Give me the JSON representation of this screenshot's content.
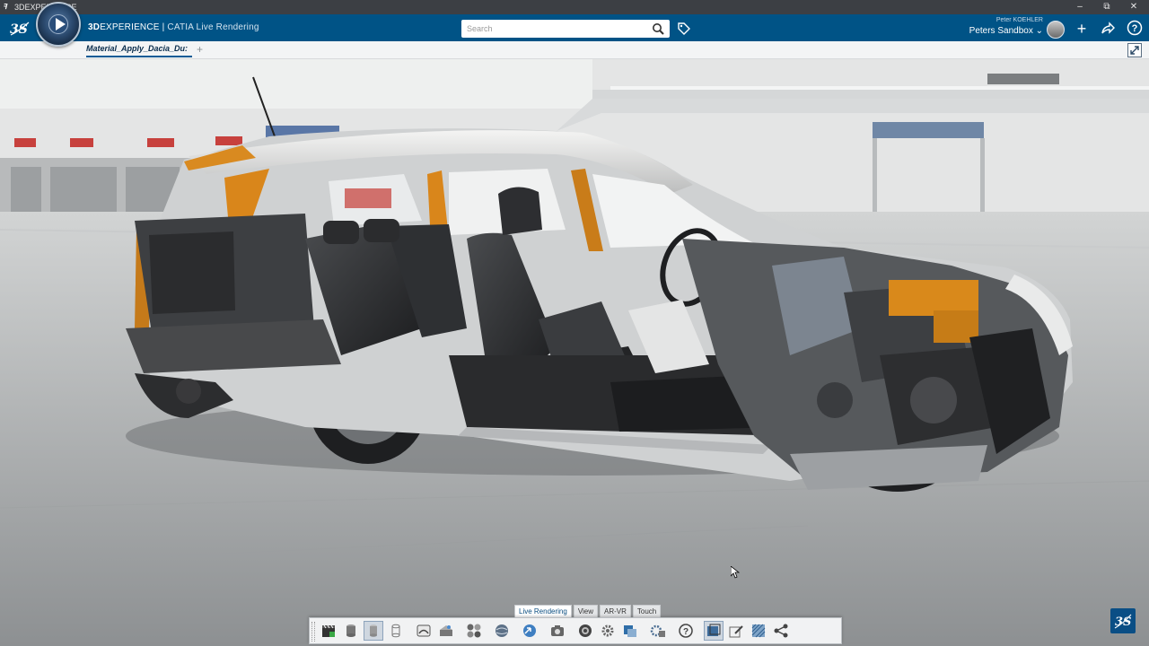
{
  "window": {
    "title": "3DEXPERIENCE",
    "controls": [
      "minimize",
      "restore",
      "close"
    ]
  },
  "header": {
    "brand_strong": "3D",
    "brand_rest": "EXPERIENCE",
    "separator": " | ",
    "app_name": "CATIA Live Rendering",
    "search_placeholder": "Search",
    "user_name": "Peter KOEHLER",
    "collab_space": "Peters Sandbox",
    "compass_icon": "compass-play-icon"
  },
  "tabs": {
    "active_tab": "Material_Apply_Dacia_Du:",
    "add_label": "+"
  },
  "viewport": {
    "content": "cutaway-car-3d-model",
    "background": "indoor-garage"
  },
  "command_bar": {
    "tabs": [
      "Live Rendering",
      "View",
      "AR-VR",
      "Touch"
    ],
    "active_tab": "Live Rendering",
    "icons": [
      "clapper-board-icon",
      "cylinder-icon",
      "cylinder-selected-icon",
      "cylinder-outline-icon",
      "material-icon",
      "environment-icon",
      "spheres-icon",
      "globe-icon",
      "globe-arrow-icon",
      "camera-icon",
      "render-icon",
      "settings-icon",
      "cube-stack-icon",
      "gear-stack-icon",
      "help-icon",
      "scene-icon",
      "edit-icon",
      "hatch-icon",
      "share-icon"
    ]
  },
  "colors": {
    "header_blue": "#005386",
    "title_gray": "#3c3f44",
    "accent_orange": "#d98a20"
  }
}
